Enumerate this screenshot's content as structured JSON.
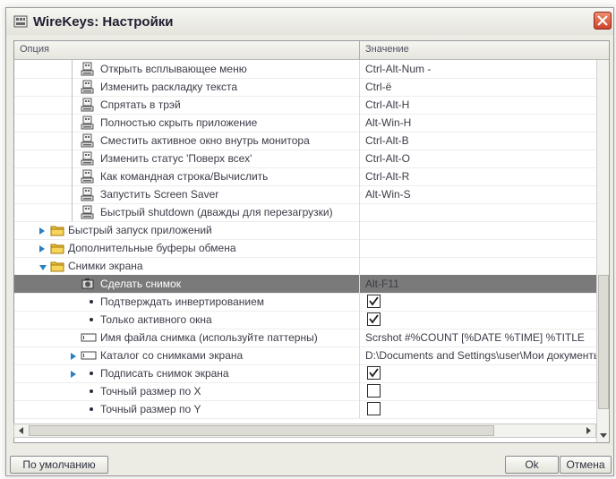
{
  "window": {
    "title": "WireKeys: Настройки",
    "app_icon": "wirekeys-app-icon",
    "close_icon": "close-icon"
  },
  "columns": {
    "option": "Опция",
    "value": "Значение"
  },
  "rows": [
    {
      "label": "Открыть всплывающее меню",
      "value": "Ctrl-Alt-Num -",
      "kind": "action"
    },
    {
      "label": "Изменить раскладку текста",
      "value": "Ctrl-ё",
      "kind": "action"
    },
    {
      "label": "Спрятать в трэй",
      "value": "Ctrl-Alt-H",
      "kind": "action"
    },
    {
      "label": "Полностью скрыть приложение",
      "value": "Alt-Win-H",
      "kind": "action"
    },
    {
      "label": "Сместить активное окно внутрь монитора",
      "value": "Ctrl-Alt-B",
      "kind": "action"
    },
    {
      "label": "Изменить статус 'Поверх всех'",
      "value": "Ctrl-Alt-O",
      "kind": "action"
    },
    {
      "label": "Как командная строка/Вычислить",
      "value": "Ctrl-Alt-R",
      "kind": "action"
    },
    {
      "label": "Запустить Screen Saver",
      "value": "Alt-Win-S",
      "kind": "action"
    },
    {
      "label": "Быстрый shutdown (дважды для перезагрузки)",
      "value": "",
      "kind": "action"
    },
    {
      "label": "Быстрый запуск приложений",
      "value": "",
      "kind": "folder"
    },
    {
      "label": "Дополнительные буферы обмена",
      "value": "",
      "kind": "folder"
    },
    {
      "label": "Снимки экрана",
      "value": "",
      "kind": "folder-open"
    },
    {
      "label": "Сделать снимок",
      "value": "Alt-F11",
      "kind": "camera"
    },
    {
      "label": "Подтверждать инвертированием",
      "checked": true,
      "kind": "check"
    },
    {
      "label": "Только активного окна",
      "checked": true,
      "kind": "check"
    },
    {
      "label": "Имя файла снимка (используйте паттерны)",
      "value": "Scrshot #%COUNT [%DATE %TIME] %TITLE",
      "kind": "field"
    },
    {
      "label": "Каталог со снимками экрана",
      "value": "D:\\Documents and Settings\\user\\Мои документы",
      "kind": "field-expand"
    },
    {
      "label": "Подписать снимок экрана",
      "checked": true,
      "kind": "check-expand"
    },
    {
      "label": "Точный размер по X",
      "checked": false,
      "kind": "check"
    },
    {
      "label": "Точный размер по Y",
      "checked": false,
      "kind": "check"
    }
  ],
  "selected_row": "Сделать снимок",
  "buttons": {
    "default": "По умолчанию",
    "ok": "Ok",
    "cancel": "Отмена"
  },
  "colors": {
    "selection": "#7a7a7a",
    "folder": "#f1c232",
    "expander": "#2a7fc0",
    "close": "#d84a30"
  }
}
